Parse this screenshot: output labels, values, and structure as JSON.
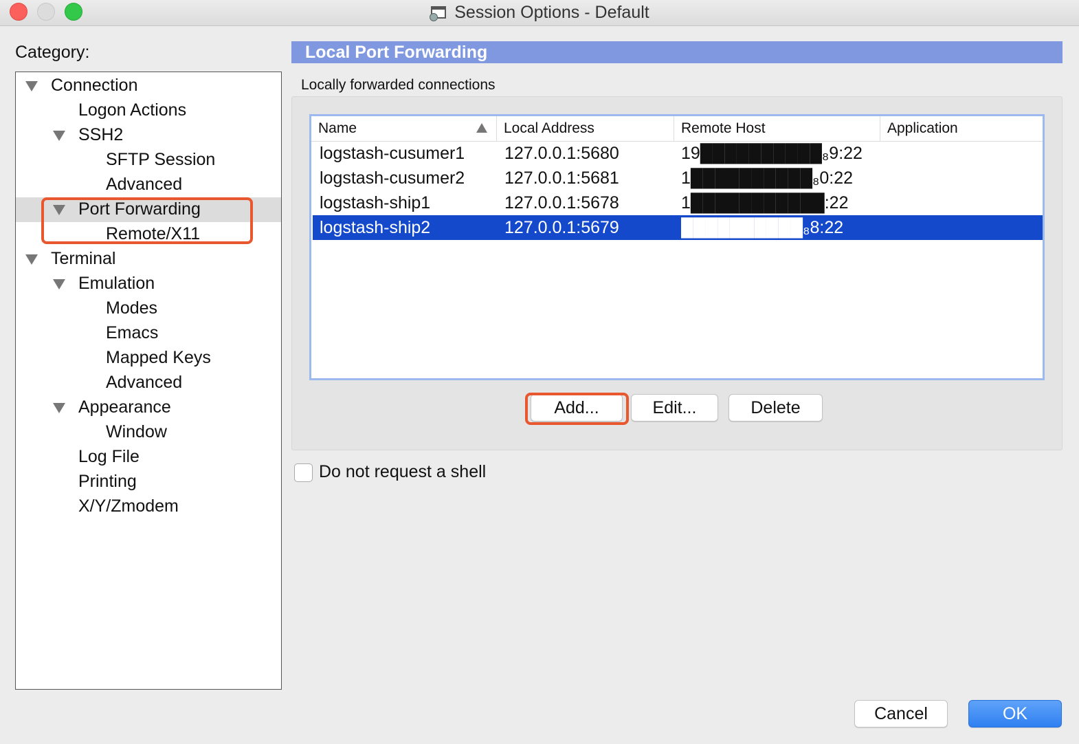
{
  "window": {
    "title": "Session Options - Default"
  },
  "category": {
    "label": "Category:",
    "items": [
      {
        "label": "Connection",
        "expanded": true
      },
      {
        "label": "Logon Actions"
      },
      {
        "label": "SSH2",
        "expanded": true
      },
      {
        "label": "SFTP Session"
      },
      {
        "label": "Advanced"
      },
      {
        "label": "Port Forwarding",
        "expanded": true,
        "selected": true
      },
      {
        "label": "Remote/X11"
      },
      {
        "label": "Terminal",
        "expanded": true
      },
      {
        "label": "Emulation",
        "expanded": true
      },
      {
        "label": "Modes"
      },
      {
        "label": "Emacs"
      },
      {
        "label": "Mapped Keys"
      },
      {
        "label": "Advanced"
      },
      {
        "label": "Appearance",
        "expanded": true
      },
      {
        "label": "Window"
      },
      {
        "label": "Log File"
      },
      {
        "label": "Printing"
      },
      {
        "label": "X/Y/Zmodem"
      }
    ]
  },
  "panel": {
    "title": "Local Port Forwarding",
    "group_label": "Locally forwarded connections",
    "table": {
      "columns": [
        "Name",
        "Local Address",
        "Remote Host",
        "Application"
      ],
      "rows": [
        {
          "name": "logstash-cusumer1",
          "local": "127.0.0.1:5680",
          "remote": "19██████████₈9:22",
          "app": ""
        },
        {
          "name": "logstash-cusumer2",
          "local": "127.0.0.1:5681",
          "remote": "1██████████₈0:22",
          "app": ""
        },
        {
          "name": "logstash-ship1",
          "local": "127.0.0.1:5678",
          "remote": "1███████████:22",
          "app": ""
        },
        {
          "name": "logstash-ship2",
          "local": "127.0.0.1:5679",
          "remote": "██████████₈8:22",
          "app": "",
          "selected": true
        }
      ]
    },
    "buttons": {
      "add": "Add...",
      "edit": "Edit...",
      "delete": "Delete"
    },
    "shell_checkbox": {
      "label": "Do not request a shell",
      "checked": false
    }
  },
  "footer": {
    "cancel": "Cancel",
    "ok": "OK"
  },
  "colors": {
    "section_header": "#7f98e0",
    "selection": "#1549cc",
    "annotation": "#e9572f",
    "primary_button": "#2f80f2"
  }
}
